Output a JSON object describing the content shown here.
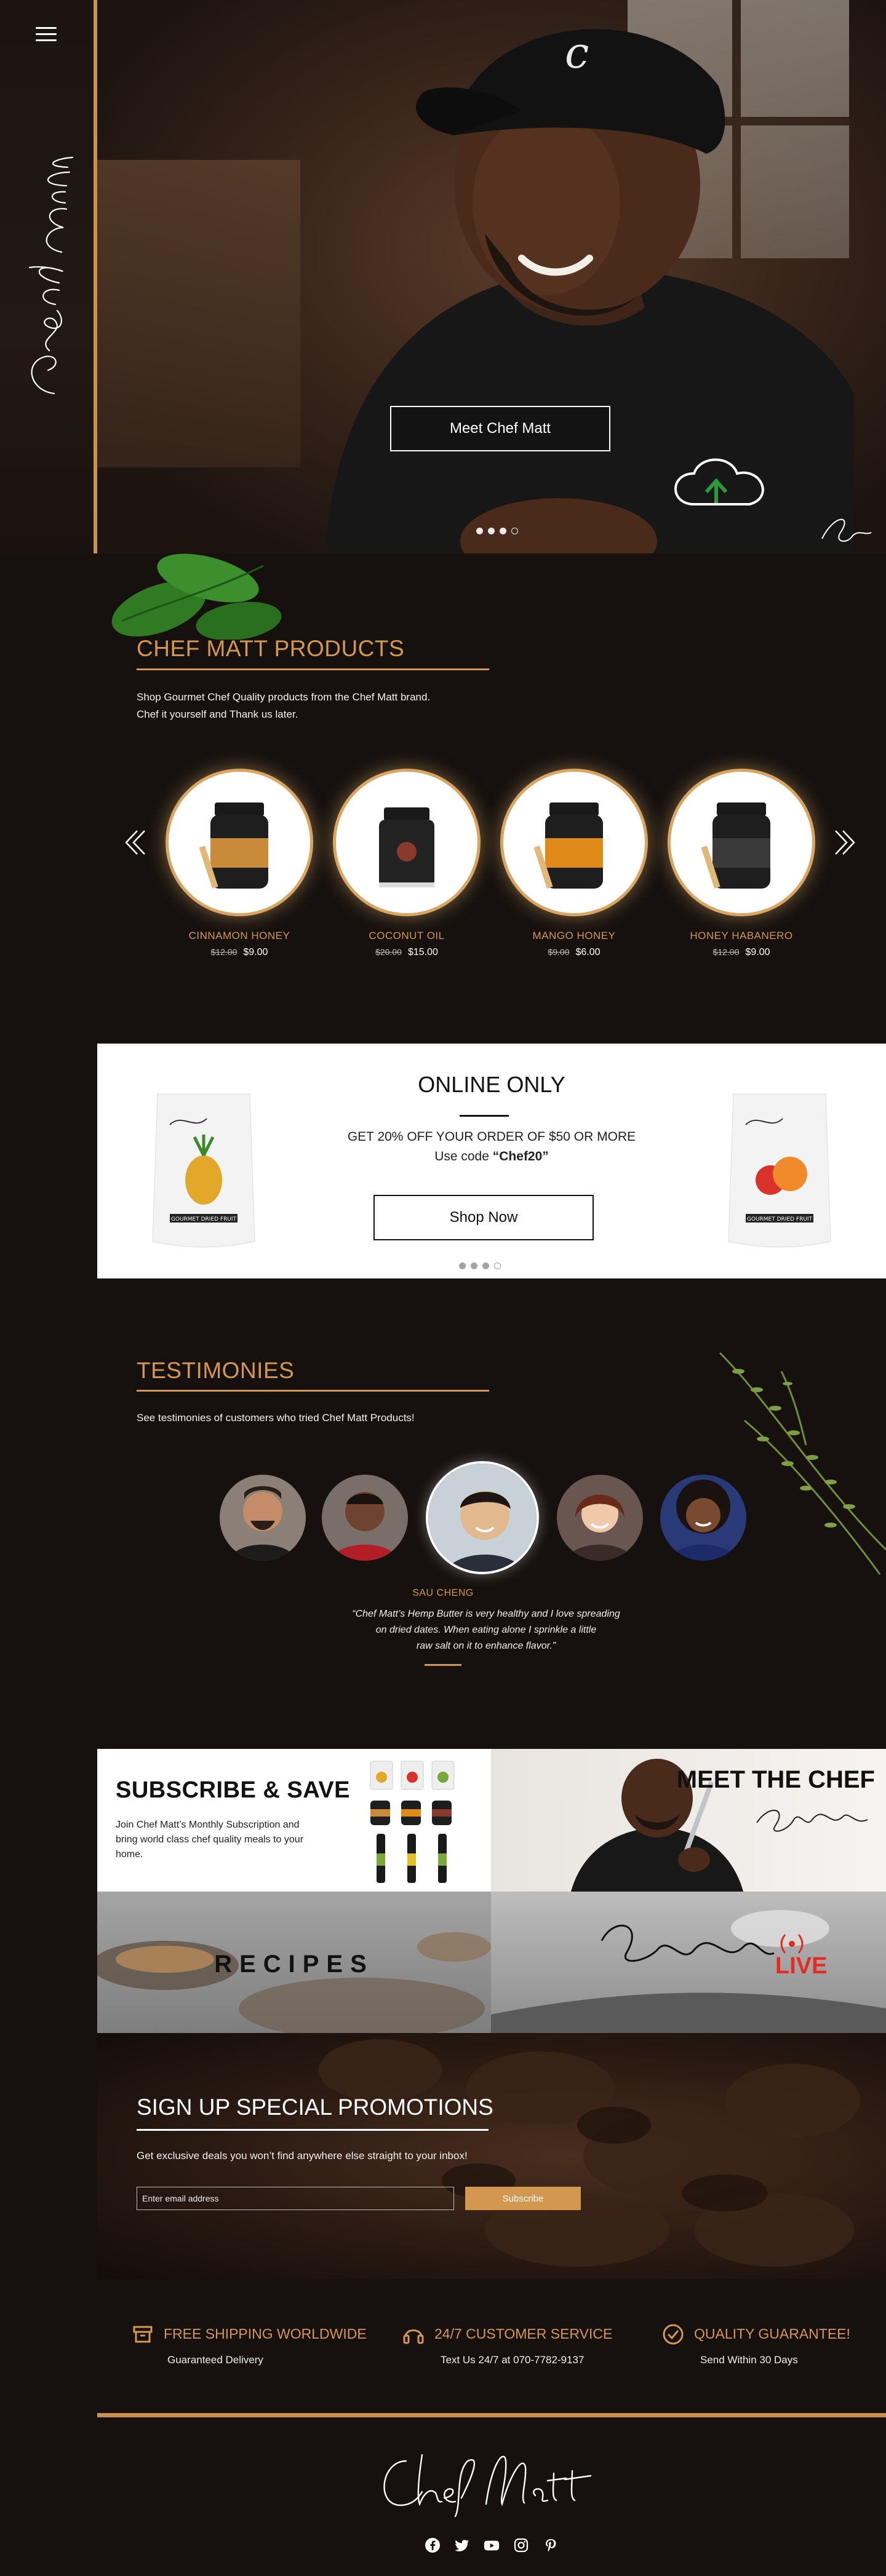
{
  "hero": {
    "button_label": "Meet Chef Matt",
    "slides": 4,
    "active_slide": 1
  },
  "products": {
    "title": "CHEF MATT PRODUCTS",
    "description_line1": "Shop Gourmet Chef Quality products from the Chef Matt brand.",
    "description_line2": "Chef it yourself and Thank us later.",
    "items": [
      {
        "name": "CINNAMON HONEY",
        "old_price": "$12.00",
        "price": "$9.00",
        "label_color": "#c98a3a"
      },
      {
        "name": "COCONUT OIL",
        "old_price": "$20.00",
        "price": "$15.00",
        "label_color": "#8a3a2a"
      },
      {
        "name": "MANGO HONEY",
        "old_price": "$9.00",
        "price": "$6.00",
        "label_color": "#e08a1a"
      },
      {
        "name": "HONEY HABANERO",
        "old_price": "$12.00",
        "price": "$9.00",
        "label_color": "#3a3a3a"
      }
    ]
  },
  "promo": {
    "title": "ONLINE ONLY",
    "line1": "GET 20% OFF YOUR ORDER OF $50 OR MORE",
    "line2_prefix": "Use code ",
    "code": "“Chef20”",
    "button_label": "Shop Now",
    "bag_label_left": "GOURMET DRIED FRUIT",
    "bag_label_right": "GOURMET DRIED FRUIT"
  },
  "testimonials": {
    "title": "TESTIMONIES",
    "description": "See testimonies of customers who tried Chef Matt Products!",
    "active_name": "SAU CHENG",
    "quote_line1": "“Chef Matt’s Hemp Butter is very healthy and I love spreading",
    "quote_line2": "on dried dates. When eating alone I sprinkle a little",
    "quote_line3": "raw salt on it to enhance flavor.”"
  },
  "tiles": {
    "subscribe_title": "SUBSCRIBE & SAVE",
    "subscribe_text": "Join Chef Matt’s Monthly Subscription and bring world class chef quality meals to your home.",
    "meet_title": "MEET THE CHEF",
    "recipes_label": "RECIPES",
    "live_label": "LIVE"
  },
  "signup": {
    "title": "SIGN UP SPECIAL PROMOTIONS",
    "description": "Get exclusive deals you won’t find anywhere else straight to your inbox!",
    "email_placeholder": "Enter email address",
    "button_label": "Subscribe"
  },
  "features": [
    {
      "icon": "archive-box-icon",
      "title": "FREE SHIPPING WORLDWIDE",
      "subtitle": "Guaranteed Delivery"
    },
    {
      "icon": "headphones-icon",
      "title": "24/7 CUSTOMER SERVICE",
      "subtitle": "Text Us 24/7 at 070-7782-9137"
    },
    {
      "icon": "check-circle-icon",
      "title": "QUALITY GUARANTEE!",
      "subtitle": "Send Within 30 Days"
    }
  ],
  "socials": [
    "facebook-icon",
    "twitter-icon",
    "youtube-icon",
    "instagram-icon",
    "pinterest-icon"
  ],
  "colors": {
    "accent": "#d4974f",
    "background": "#16110f"
  }
}
